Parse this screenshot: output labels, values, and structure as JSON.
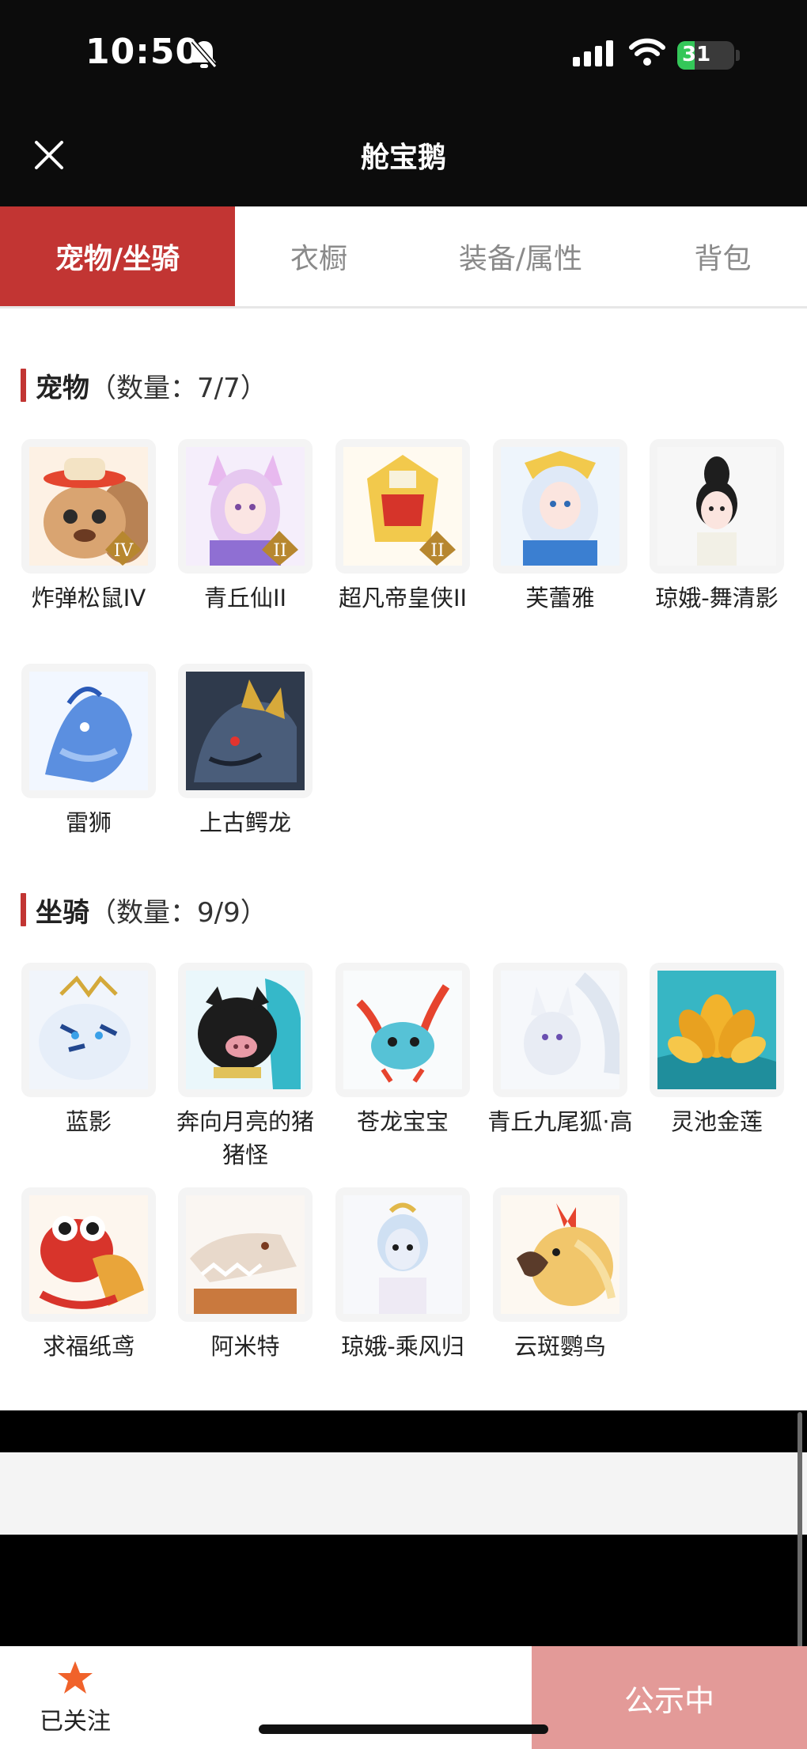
{
  "status_bar": {
    "time": "10:50",
    "battery": "31",
    "battery_level": 0.31
  },
  "header": {
    "title": "舱宝鹅"
  },
  "tabs": [
    {
      "label": "宠物/坐骑",
      "active": true
    },
    {
      "label": "衣橱",
      "active": false
    },
    {
      "label": "装备/属性",
      "active": false
    },
    {
      "label": "背包",
      "active": false
    }
  ],
  "pets": {
    "title": "宠物",
    "count": "（数量：7/7）",
    "items": [
      {
        "label": "炸弹松鼠IV",
        "badge": "IV"
      },
      {
        "label": "青丘仙II",
        "badge": "II"
      },
      {
        "label": "超凡帝皇侠II",
        "badge": "II"
      },
      {
        "label": "芙蕾雅"
      },
      {
        "label": "琼娥-舞清影"
      },
      {
        "label": "雷狮"
      },
      {
        "label": "上古鳄龙"
      }
    ]
  },
  "mounts": {
    "title": "坐骑",
    "count": "（数量：9/9）",
    "items": [
      {
        "label": "蓝影"
      },
      {
        "label": "奔向月亮的猪猪怪"
      },
      {
        "label": "苍龙宝宝"
      },
      {
        "label": "青丘九尾狐·高"
      },
      {
        "label": "灵池金莲"
      },
      {
        "label": "求福纸鸢"
      },
      {
        "label": "阿米特"
      },
      {
        "label": "琼娥-乘风归"
      },
      {
        "label": "云斑鹦鸟"
      }
    ]
  },
  "bottom_bar": {
    "follow_label": "已关注",
    "public_label": "公示中"
  },
  "colors": {
    "accent": "#c23533",
    "public_button": "#e39a98",
    "star": "#f0622b"
  }
}
